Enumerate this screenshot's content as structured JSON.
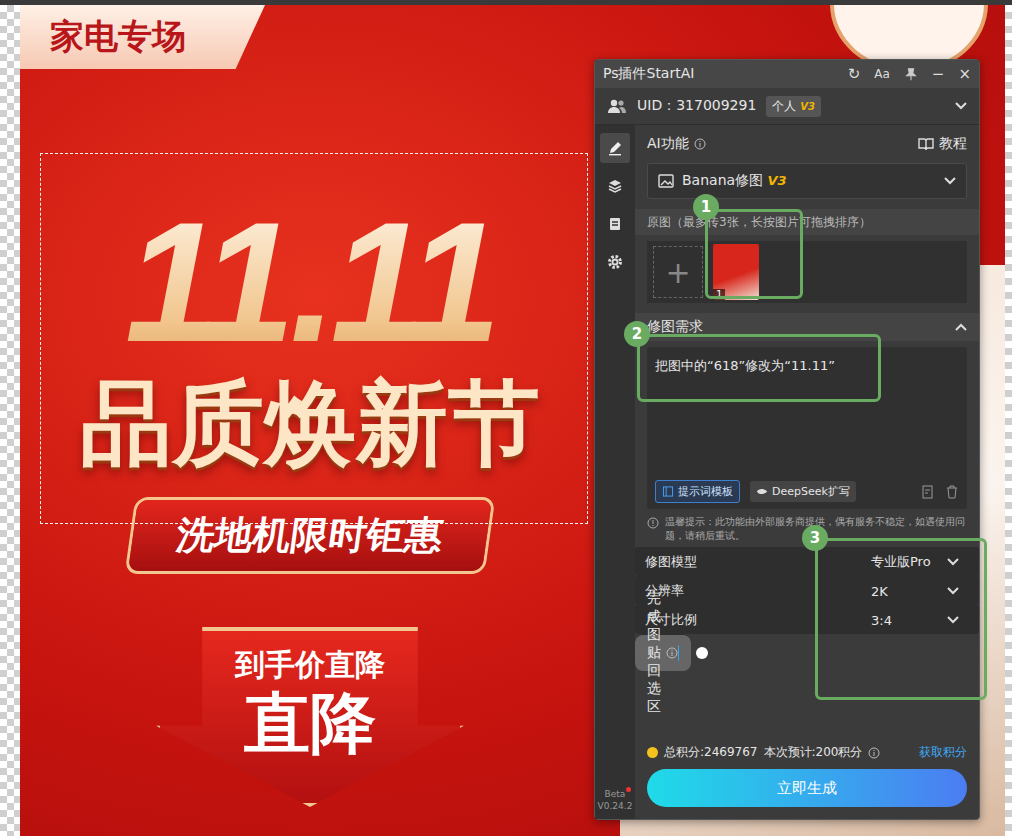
{
  "poster": {
    "tag": "家电专场",
    "big_title": "11.11",
    "title": "品质焕新节",
    "ribbon": "洗地机限时钜惠",
    "arrow_top": "到手价直降",
    "arrow_bottom": "直降",
    "selection_visible": true
  },
  "panel": {
    "title": "Ps插件StartAI",
    "header_buttons": [
      "↻",
      "Aa",
      "−",
      "×"
    ],
    "uid": "UID：317009291",
    "plan": "个人",
    "plan_badge": "V3",
    "sidebar_items": [
      {
        "selected": true
      },
      {
        "selected": false
      },
      {
        "selected": false
      },
      {
        "selected": false
      }
    ],
    "beta": "Beta",
    "version": "V0.24.2",
    "ai_function": {
      "label": "AI功能",
      "tutorial": "教程",
      "value": "Banana修图",
      "value_badge": "V3"
    },
    "source": {
      "label": "原图（最多传3张，长按图片可拖拽排序）",
      "add": "+",
      "images": [
        {
          "index": "1"
        }
      ]
    },
    "request": {
      "label": "修图需求",
      "expanded": true,
      "text": "把图中的“618”修改为“11.11”",
      "template_button": "提示词模板",
      "deepseek_button": "DeepSeek扩写"
    },
    "notice": "温馨提示：此功能由外部服务商提供，偶有服务不稳定，如遇使用问题，请稍后重试。",
    "settings": [
      {
        "label": "修图模型",
        "kind": "select",
        "value": "专业版Pro"
      },
      {
        "label": "分辨率",
        "kind": "select",
        "value": "2K"
      },
      {
        "label": "尺寸比例",
        "kind": "select",
        "value": "3:4"
      },
      {
        "label": "完成图贴回选区",
        "kind": "toggle",
        "on": true
      }
    ],
    "footer": {
      "total": "总积分:2469767",
      "estimate": "本次预计:200积分",
      "get_points": "获取积分",
      "generate": "立即生成"
    }
  },
  "annotations": [
    {
      "label": "1"
    },
    {
      "label": "2"
    },
    {
      "label": "3"
    }
  ]
}
